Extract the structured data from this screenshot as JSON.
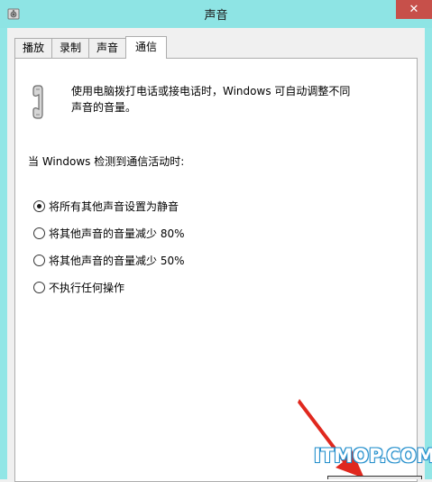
{
  "window": {
    "title": "声音",
    "close_label": "✕"
  },
  "tabs": [
    {
      "label": "播放",
      "active": false
    },
    {
      "label": "录制",
      "active": false
    },
    {
      "label": "声音",
      "active": false
    },
    {
      "label": "通信",
      "active": true
    }
  ],
  "panel": {
    "description_line1": "使用电脑拨打电话或接电话时，Windows 可自动调整不同",
    "description_line2": "声音的音量。",
    "heading": "当 Windows 检测到通信活动时:",
    "options": [
      {
        "label": "将所有其他声音设置为静音",
        "checked": true
      },
      {
        "label": "将其他声音的音量减少 80%",
        "checked": false
      },
      {
        "label": "将其他声音的音量减少 50%",
        "checked": false
      },
      {
        "label": "不执行任何操作",
        "checked": false
      }
    ]
  },
  "watermark": "ITMOP.COM",
  "colors": {
    "frame": "#92e6e6",
    "close": "#c7504a",
    "arrow": "#e0281e"
  }
}
